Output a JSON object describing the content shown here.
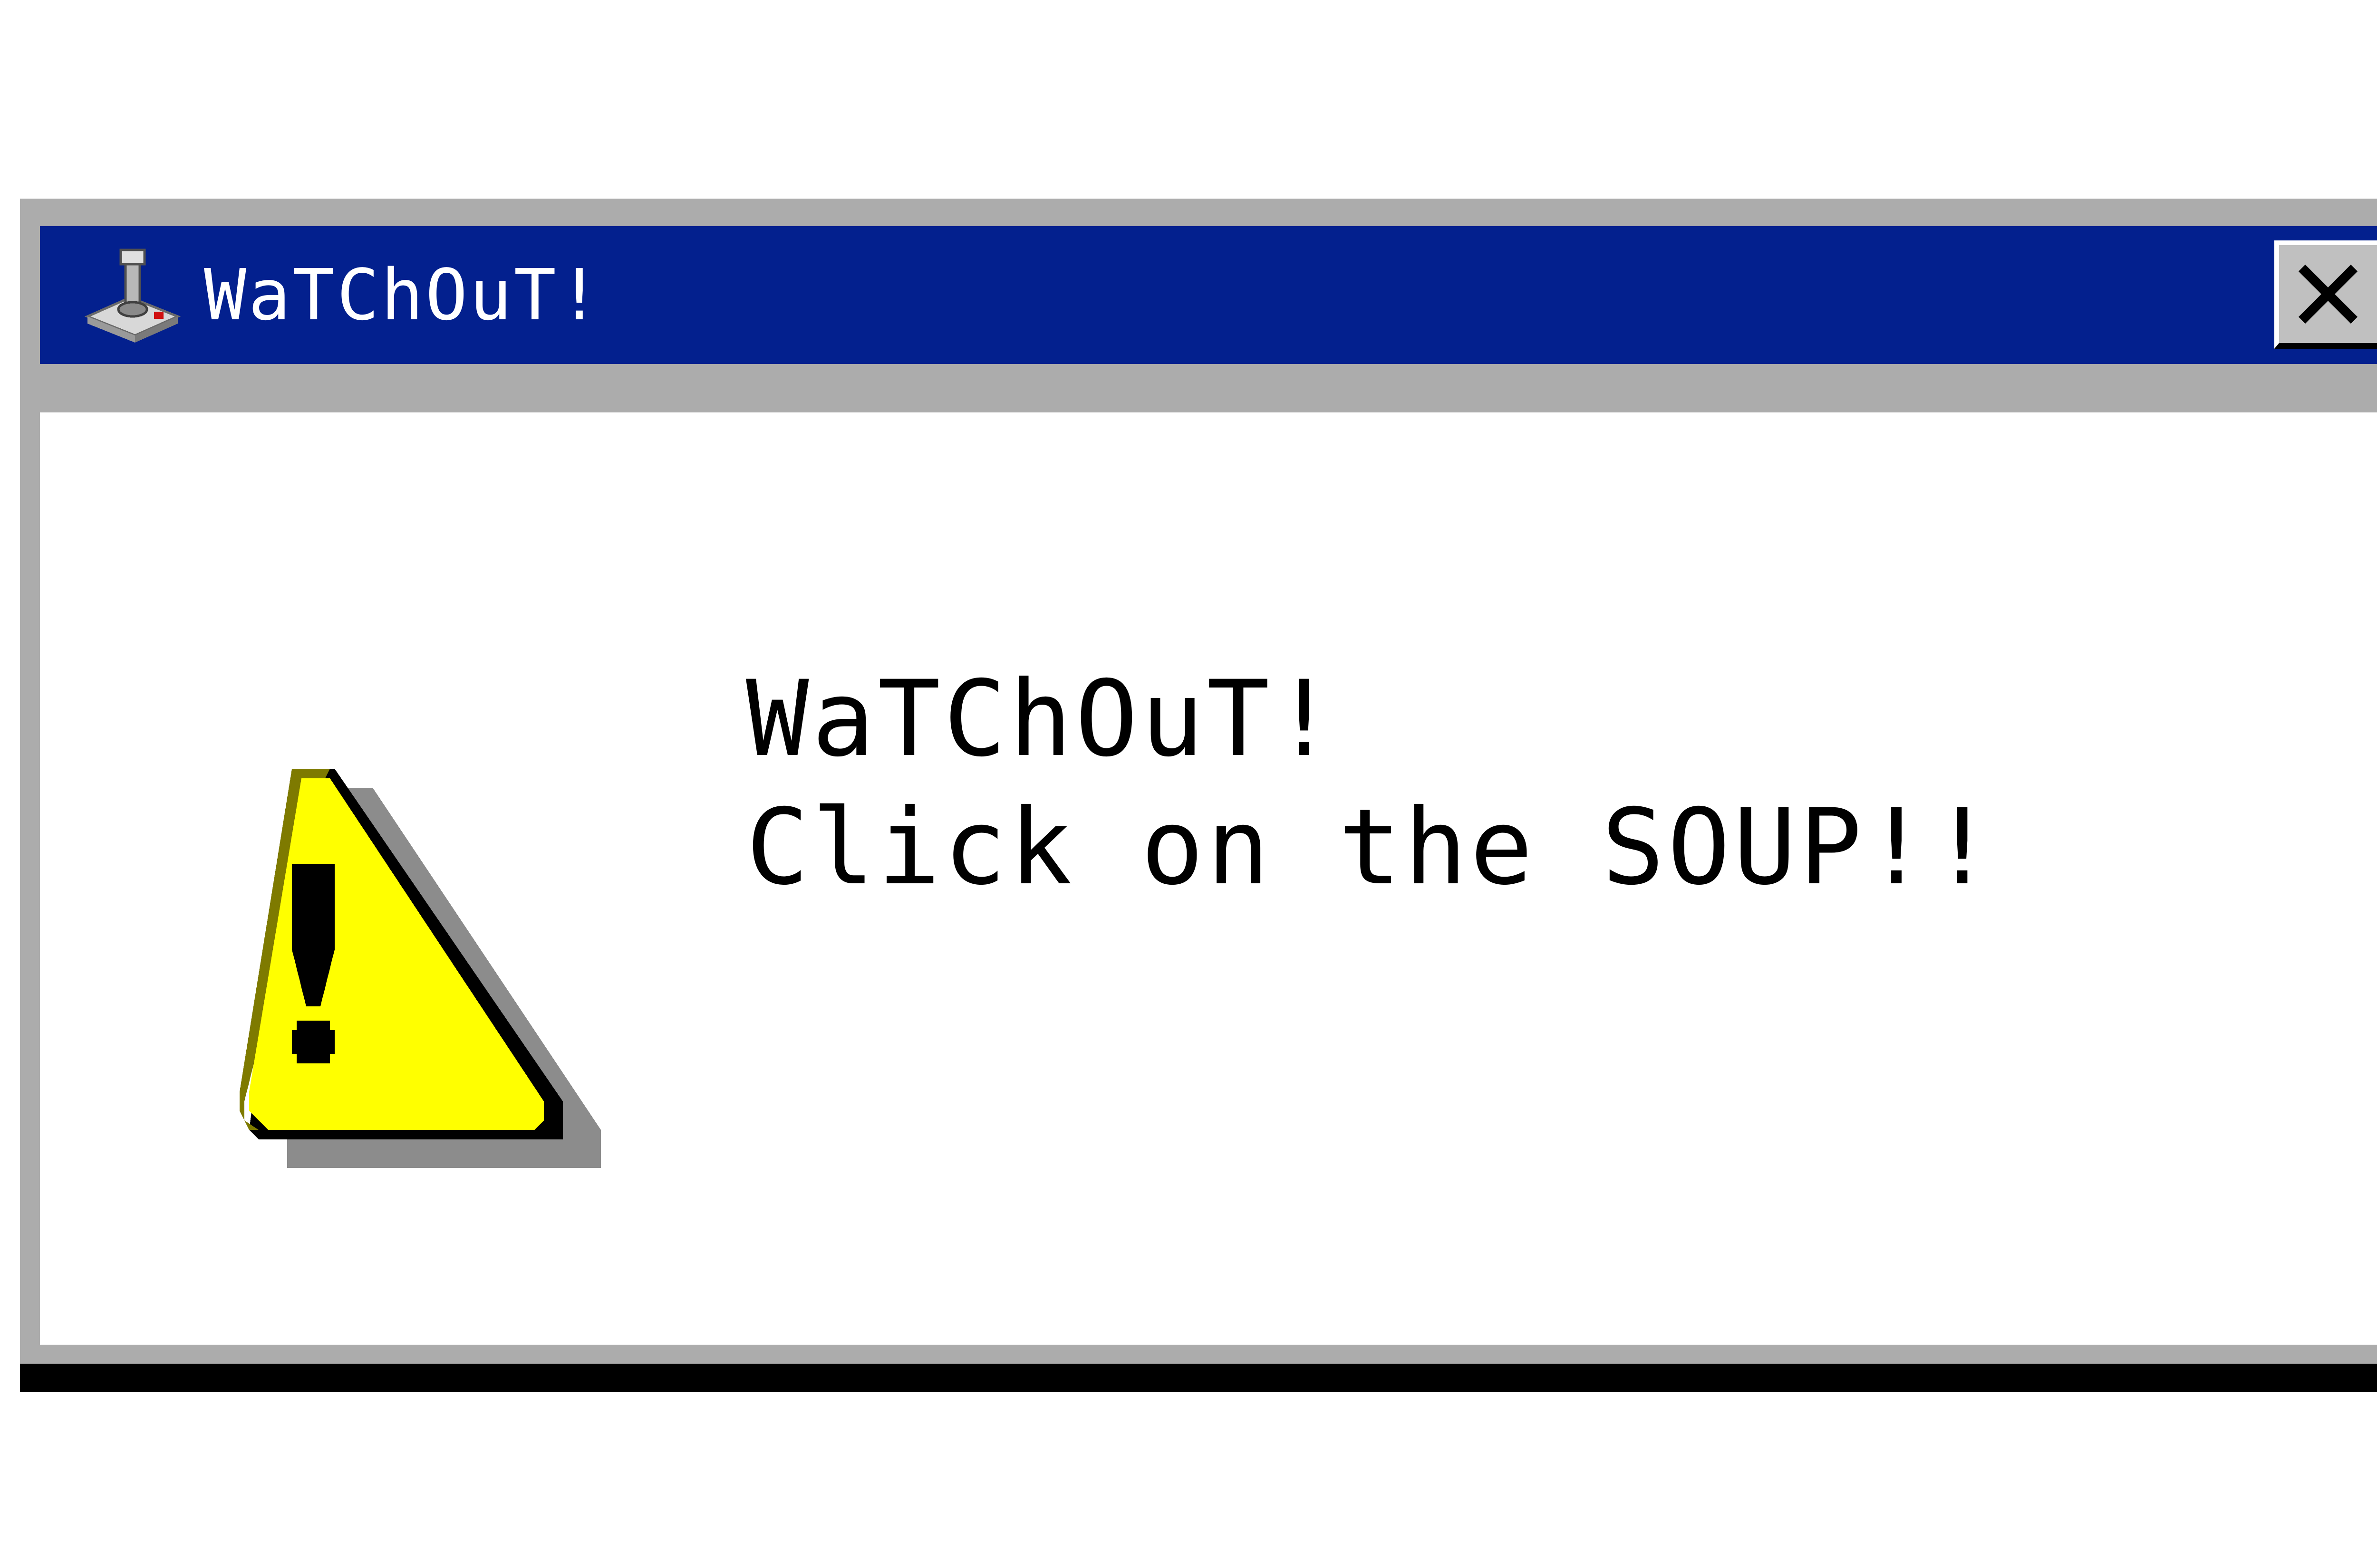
{
  "window": {
    "title": "WaTChOuT!",
    "app_icon": "joystick-icon",
    "close_icon": "close-icon",
    "colors": {
      "titlebar": "#03208e",
      "frame": "#acacac",
      "content": "#ffffff",
      "warning_fill": "#ffff00"
    }
  },
  "dialog": {
    "icon": "warning-icon",
    "message_line1": "WaTChOuT!",
    "message_line2": "Click on the SOUP!!"
  }
}
